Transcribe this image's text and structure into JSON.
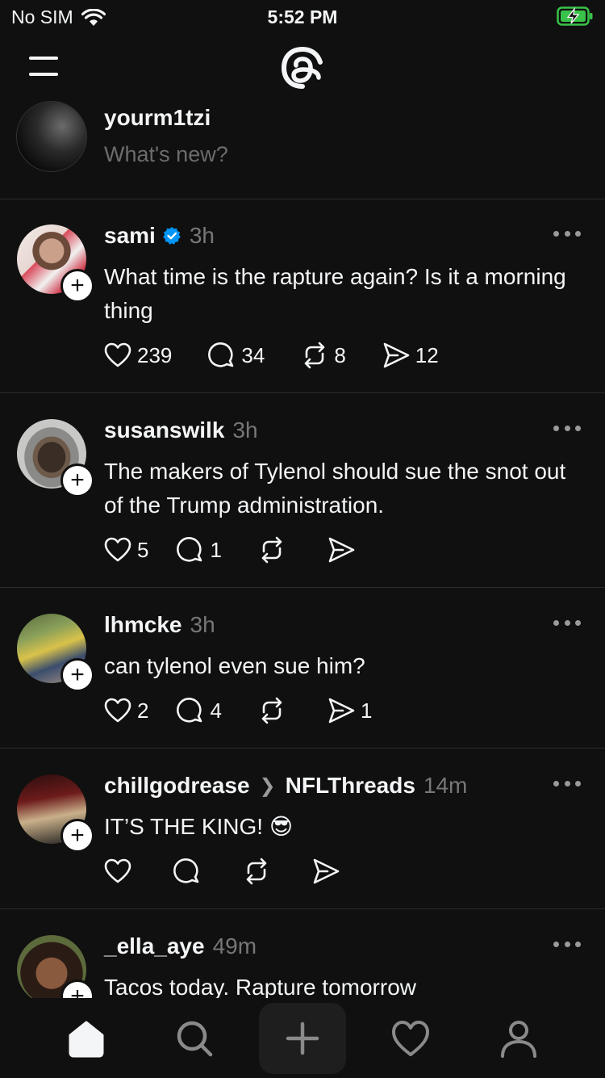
{
  "status_bar": {
    "carrier": "No SIM",
    "time": "5:52 PM"
  },
  "composer": {
    "username": "yourm1tzi",
    "placeholder": "What's new?"
  },
  "posts": [
    {
      "username": "sami",
      "verified": true,
      "time": "3h",
      "text": "What time is the rapture again? Is it a morning thing",
      "likes": "239",
      "replies": "34",
      "reposts": "8",
      "shares": "12"
    },
    {
      "username": "susanswilk",
      "time": "3h",
      "text": "The makers of Tylenol should sue the snot out of the Trump administration.",
      "likes": "5",
      "replies": "1",
      "reposts": "",
      "shares": ""
    },
    {
      "username": "lhmcke",
      "time": "3h",
      "text": "can tylenol even sue him?",
      "likes": "2",
      "replies": "4",
      "reposts": "",
      "shares": "1"
    },
    {
      "username": "chillgodrease",
      "community": "NFLThreads",
      "time": "14m",
      "text": "IT’S THE KING! 😎",
      "likes": "",
      "replies": "",
      "reposts": "",
      "shares": ""
    },
    {
      "username": "_ella_aye",
      "time": "49m",
      "text": "Tacos today. Rapture tomorrow"
    }
  ],
  "colors": {
    "background": "#101010",
    "verified": "#0095f6",
    "muted": "#777777"
  },
  "tabs": [
    "home-icon",
    "search-icon",
    "compose-icon",
    "heart-icon",
    "profile-icon"
  ]
}
